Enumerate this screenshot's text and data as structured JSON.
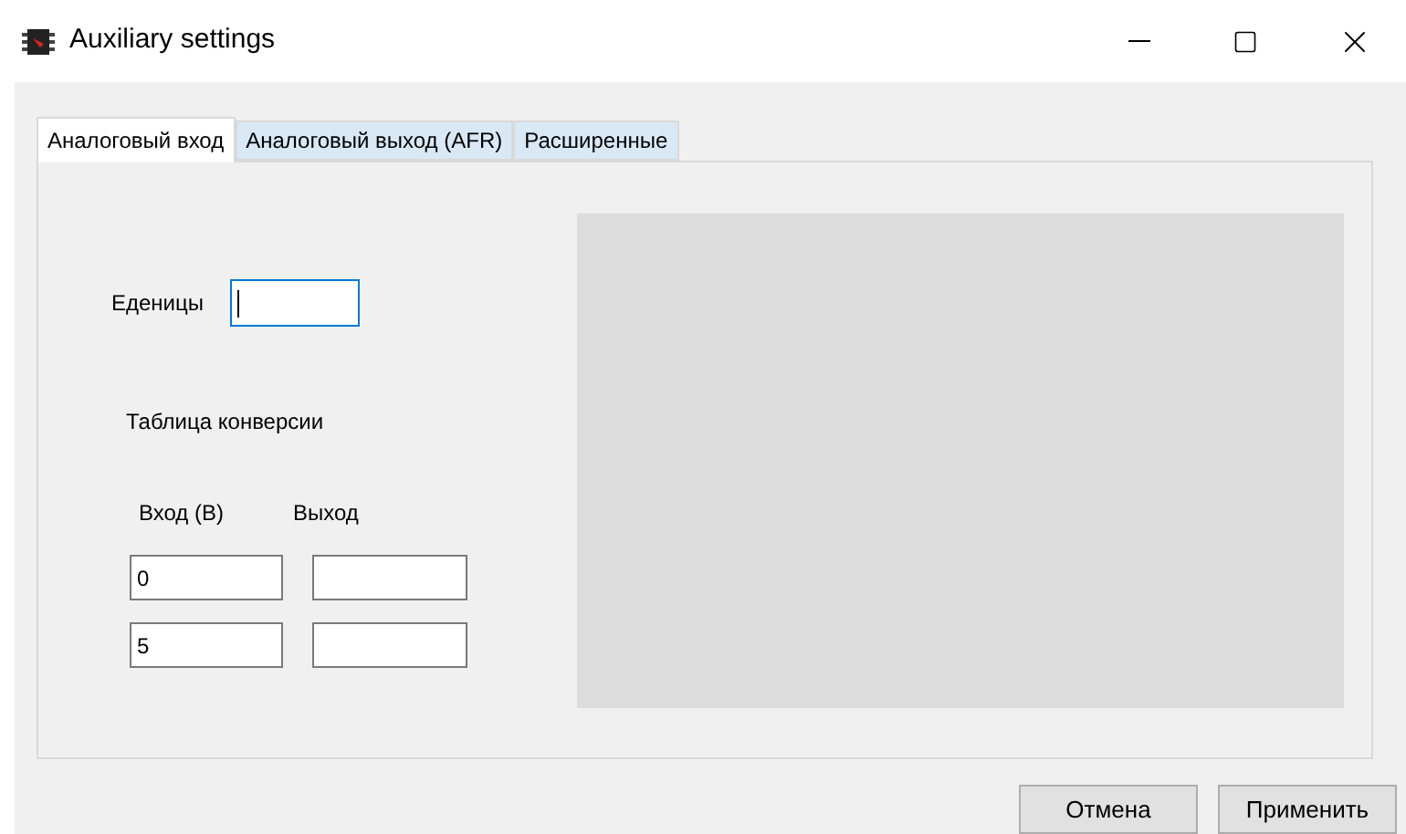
{
  "window": {
    "title": "Auxiliary settings"
  },
  "tabs": [
    {
      "label": "Аналоговый вход",
      "selected": true
    },
    {
      "label": "Аналоговый выход (AFR)",
      "selected": false
    },
    {
      "label": "Расширенные",
      "selected": false
    }
  ],
  "units": {
    "label": "Еденицы",
    "focused": true
  },
  "conversion_table": {
    "title": "Таблица конверсии",
    "columns": [
      "Вход (В)",
      "Выход"
    ],
    "rows": [
      {
        "input": "0"
      },
      {
        "input": "5"
      }
    ]
  },
  "buttons": [
    "Отмена",
    "Применить"
  ]
}
